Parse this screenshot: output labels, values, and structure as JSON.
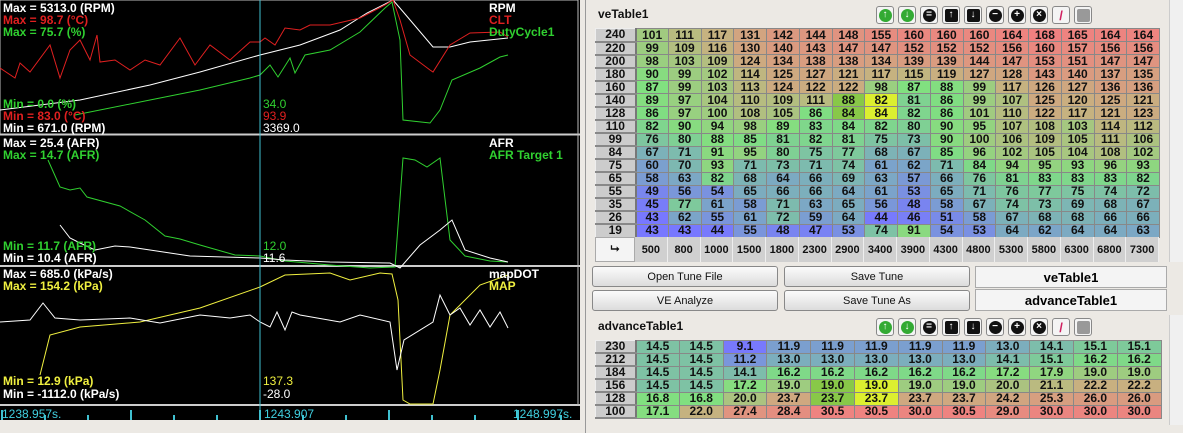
{
  "charts": [
    {
      "max": [
        {
          "text": "Max = 5313.0 (RPM)",
          "c": "w"
        },
        {
          "text": "Max = 98.7 (°C)",
          "c": "r"
        },
        {
          "text": "Max = 75.7 (%)",
          "c": "g"
        }
      ],
      "min": [
        {
          "text": "Min = 0.0 (%)",
          "c": "g"
        },
        {
          "text": "Min = 83.0 (°C)",
          "c": "r"
        },
        {
          "text": "Min = 671.0 (RPM)",
          "c": "w"
        }
      ],
      "cursor": [
        {
          "text": "34.0",
          "c": "g"
        },
        {
          "text": "93.9",
          "c": "r"
        },
        {
          "text": "3369.0",
          "c": "w"
        }
      ],
      "legend": [
        {
          "text": "RPM",
          "c": "w"
        },
        {
          "text": "CLT",
          "c": "r"
        },
        {
          "text": "DutyCycle1",
          "c": "g"
        }
      ]
    },
    {
      "max": [
        {
          "text": "Max = 25.4 (AFR)",
          "c": "w"
        },
        {
          "text": "Max = 14.7 (AFR)",
          "c": "g"
        }
      ],
      "min": [
        {
          "text": "Min = 11.7 (AFR)",
          "c": "g"
        },
        {
          "text": "Min = 10.4 (AFR)",
          "c": "w"
        }
      ],
      "cursor": [
        {
          "text": "12.0",
          "c": "g"
        },
        {
          "text": "11.6",
          "c": "w"
        }
      ],
      "legend": [
        {
          "text": "AFR",
          "c": "w"
        },
        {
          "text": "AFR Target 1",
          "c": "g"
        }
      ]
    },
    {
      "max": [
        {
          "text": "Max = 685.0 (kPa/s)",
          "c": "w"
        },
        {
          "text": "Max = 154.2 (kPa)",
          "c": "y"
        }
      ],
      "min": [
        {
          "text": "Min = 12.9 (kPa)",
          "c": "y"
        },
        {
          "text": "Min = -1112.0 (kPa/s)",
          "c": "w"
        }
      ],
      "cursor": [
        {
          "text": "137.3",
          "c": "y"
        },
        {
          "text": "-28.0",
          "c": "w"
        }
      ],
      "legend": [
        {
          "text": "mapDOT",
          "c": "w"
        },
        {
          "text": "MAP",
          "c": "y"
        }
      ]
    }
  ],
  "timeline": {
    "start": "1238.957s.",
    "cursor": "1243.907",
    "end": "1248.997s."
  },
  "toolbar_icons": [
    "arrow-up-green-icon",
    "arrow-down-green-icon",
    "equals-icon",
    "arrow-up-icon",
    "arrow-down-icon",
    "minus-icon",
    "plus-icon",
    "multiply-icon",
    "pen-icon",
    "square-icon"
  ],
  "veTable": {
    "title": "veTable1",
    "rows": [
      "240",
      "220",
      "200",
      "180",
      "160",
      "140",
      "128",
      "110",
      "99",
      "84",
      "75",
      "65",
      "55",
      "35",
      "26",
      "19"
    ],
    "cols": [
      "500",
      "800",
      "1000",
      "1500",
      "1800",
      "2300",
      "2900",
      "3400",
      "3900",
      "4300",
      "4800",
      "5300",
      "5800",
      "6300",
      "6800",
      "7300"
    ],
    "values": [
      [
        101,
        111,
        117,
        131,
        142,
        144,
        148,
        155,
        160,
        160,
        160,
        164,
        168,
        165,
        164,
        164
      ],
      [
        99,
        109,
        116,
        130,
        140,
        143,
        147,
        147,
        152,
        152,
        152,
        156,
        160,
        157,
        156,
        156
      ],
      [
        98,
        103,
        109,
        124,
        134,
        138,
        138,
        134,
        139,
        139,
        144,
        147,
        153,
        151,
        147,
        147
      ],
      [
        90,
        99,
        102,
        114,
        125,
        127,
        121,
        117,
        115,
        119,
        127,
        128,
        143,
        140,
        137,
        135
      ],
      [
        87,
        99,
        103,
        113,
        124,
        122,
        122,
        98,
        87,
        88,
        99,
        117,
        126,
        127,
        136,
        136
      ],
      [
        89,
        97,
        104,
        110,
        109,
        111,
        88,
        82,
        81,
        86,
        99,
        107,
        125,
        120,
        125,
        121
      ],
      [
        86,
        97,
        100,
        108,
        105,
        86,
        84,
        84,
        82,
        86,
        101,
        110,
        122,
        117,
        121,
        123
      ],
      [
        82,
        90,
        94,
        98,
        89,
        83,
        84,
        82,
        80,
        90,
        95,
        107,
        108,
        103,
        114,
        112
      ],
      [
        76,
        80,
        88,
        85,
        81,
        82,
        81,
        75,
        73,
        90,
        100,
        106,
        109,
        105,
        111,
        106
      ],
      [
        67,
        71,
        91,
        95,
        80,
        75,
        77,
        68,
        67,
        85,
        96,
        102,
        105,
        104,
        108,
        102
      ],
      [
        60,
        70,
        93,
        71,
        73,
        71,
        74,
        61,
        62,
        71,
        84,
        94,
        95,
        93,
        96,
        93
      ],
      [
        58,
        63,
        82,
        68,
        64,
        66,
        69,
        63,
        57,
        66,
        76,
        81,
        83,
        83,
        83,
        82
      ],
      [
        49,
        56,
        54,
        65,
        66,
        66,
        64,
        61,
        53,
        65,
        71,
        76,
        77,
        75,
        74,
        72
      ],
      [
        45,
        77,
        61,
        58,
        71,
        63,
        65,
        56,
        48,
        58,
        67,
        74,
        73,
        69,
        68,
        67
      ],
      [
        43,
        62,
        55,
        61,
        72,
        59,
        64,
        44,
        46,
        51,
        58,
        67,
        68,
        68,
        66,
        66
      ],
      [
        43,
        43,
        44,
        55,
        48,
        47,
        53,
        74,
        91,
        54,
        53,
        64,
        62,
        64,
        64,
        63
      ]
    ],
    "active_cells": [
      [
        5,
        6
      ],
      [
        6,
        6
      ]
    ],
    "cursor_cells": [
      [
        5,
        7
      ],
      [
        6,
        7
      ]
    ]
  },
  "buttons": {
    "open": "Open Tune File",
    "save": "Save Tune",
    "ve_analyze": "VE Analyze",
    "save_as": "Save Tune As"
  },
  "table_tabs": [
    "veTable1",
    "advanceTable1"
  ],
  "advanceTable": {
    "title": "advanceTable1",
    "rows": [
      "230",
      "212",
      "184",
      "156",
      "128",
      "100"
    ],
    "values": [
      [
        "14.5",
        "14.5",
        "9.1",
        "11.9",
        "11.9",
        "11.9",
        "11.9",
        "11.9",
        "13.0",
        "14.1",
        "15.1",
        "15.1"
      ],
      [
        "14.5",
        "14.5",
        "11.2",
        "13.0",
        "13.0",
        "13.0",
        "13.0",
        "13.0",
        "14.1",
        "15.1",
        "16.2",
        "16.2"
      ],
      [
        "14.5",
        "14.5",
        "14.1",
        "16.2",
        "16.2",
        "16.2",
        "16.2",
        "16.2",
        "17.2",
        "17.9",
        "19.0",
        "19.0"
      ],
      [
        "14.5",
        "14.5",
        "17.2",
        "19.0",
        "19.0",
        "19.0",
        "19.0",
        "19.0",
        "20.0",
        "21.1",
        "22.2",
        "22.2"
      ],
      [
        "16.8",
        "16.8",
        "20.0",
        "23.7",
        "23.7",
        "23.7",
        "23.7",
        "23.7",
        "24.2",
        "25.3",
        "26.0",
        "26.0"
      ],
      [
        "17.1",
        "22.0",
        "27.4",
        "28.4",
        "30.5",
        "30.5",
        "30.0",
        "30.5",
        "29.0",
        "30.0",
        "30.0",
        "30.0"
      ]
    ],
    "active_cells": [
      [
        3,
        4
      ],
      [
        4,
        4
      ]
    ],
    "cursor_cells": [
      [
        3,
        5
      ],
      [
        4,
        5
      ]
    ]
  }
}
